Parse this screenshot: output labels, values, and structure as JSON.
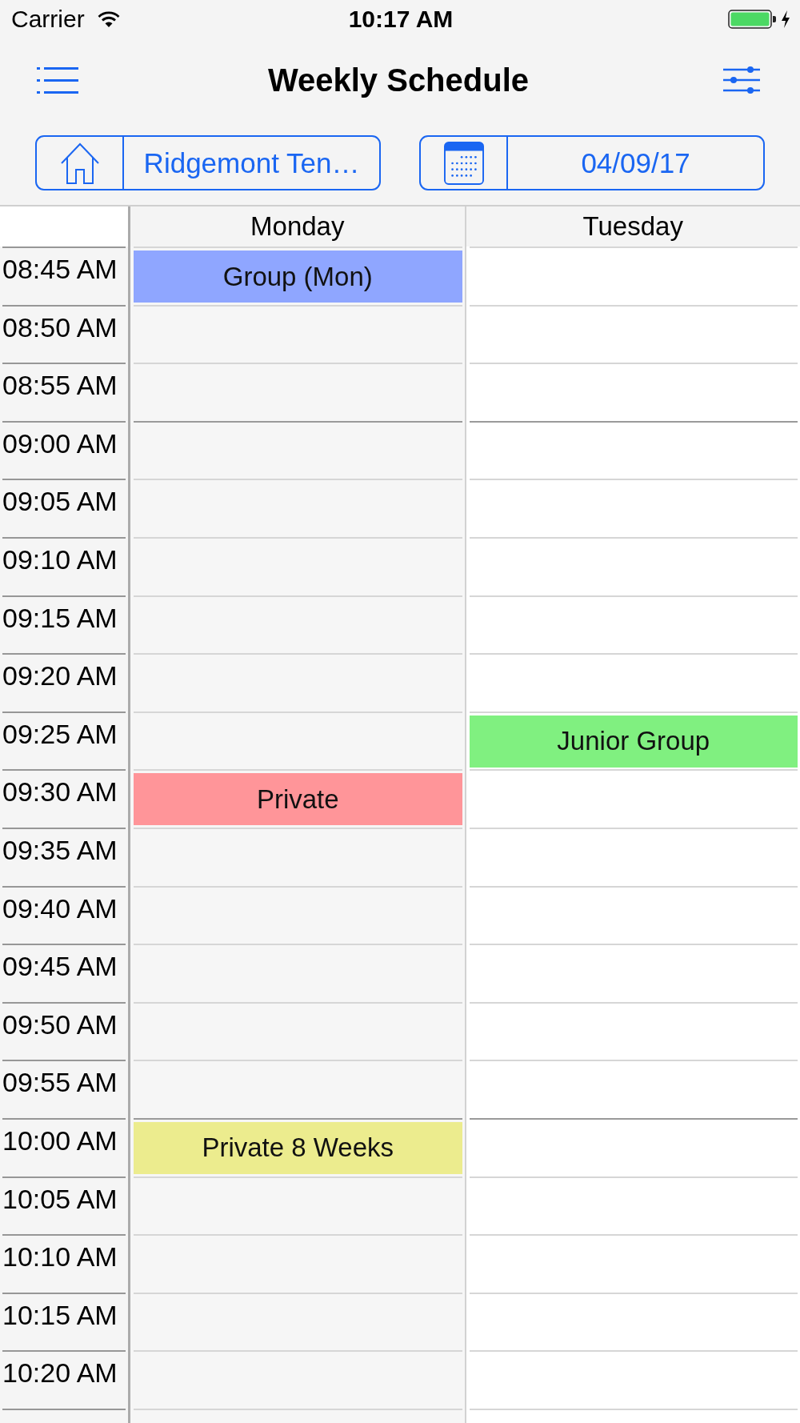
{
  "status_bar": {
    "carrier": "Carrier",
    "time": "10:17 AM"
  },
  "nav_bar": {
    "title": "Weekly Schedule"
  },
  "selectors": [
    {
      "kind": "location",
      "value": "Ridgemont Ten…"
    },
    {
      "kind": "date",
      "value": "04/09/17"
    }
  ],
  "schedule": {
    "days": [
      {
        "name": "Monday"
      },
      {
        "name": "Tuesday"
      }
    ],
    "rows": [
      {
        "time": "08:45 AM",
        "kind": "minor",
        "cells": [
          {
            "kind": "event",
            "title": "Group (Mon)",
            "color": "#8fa6ff"
          },
          {
            "kind": "free"
          }
        ]
      },
      {
        "time": "08:50 AM",
        "kind": "minor",
        "cells": [
          {
            "kind": "free"
          },
          {
            "kind": "free"
          }
        ]
      },
      {
        "time": "08:55 AM",
        "kind": "minor",
        "cells": [
          {
            "kind": "free"
          },
          {
            "kind": "free"
          }
        ]
      },
      {
        "time": "09:00 AM",
        "kind": "hour",
        "cells": [
          {
            "kind": "free"
          },
          {
            "kind": "free"
          }
        ]
      },
      {
        "time": "09:05 AM",
        "kind": "minor",
        "cells": [
          {
            "kind": "free"
          },
          {
            "kind": "free"
          }
        ]
      },
      {
        "time": "09:10 AM",
        "kind": "minor",
        "cells": [
          {
            "kind": "free"
          },
          {
            "kind": "free"
          }
        ]
      },
      {
        "time": "09:15 AM",
        "kind": "minor",
        "cells": [
          {
            "kind": "free"
          },
          {
            "kind": "free"
          }
        ]
      },
      {
        "time": "09:20 AM",
        "kind": "minor",
        "cells": [
          {
            "kind": "free"
          },
          {
            "kind": "free"
          }
        ]
      },
      {
        "time": "09:25 AM",
        "kind": "minor",
        "cells": [
          {
            "kind": "free"
          },
          {
            "kind": "event",
            "title": "Junior Group",
            "color": "#80f080"
          }
        ]
      },
      {
        "time": "09:30 AM",
        "kind": "minor",
        "cells": [
          {
            "kind": "event",
            "title": "Private",
            "color": "#ff9599"
          },
          {
            "kind": "free"
          }
        ]
      },
      {
        "time": "09:35 AM",
        "kind": "minor",
        "cells": [
          {
            "kind": "free"
          },
          {
            "kind": "free"
          }
        ]
      },
      {
        "time": "09:40 AM",
        "kind": "minor",
        "cells": [
          {
            "kind": "free"
          },
          {
            "kind": "free"
          }
        ]
      },
      {
        "time": "09:45 AM",
        "kind": "minor",
        "cells": [
          {
            "kind": "free"
          },
          {
            "kind": "free"
          }
        ]
      },
      {
        "time": "09:50 AM",
        "kind": "minor",
        "cells": [
          {
            "kind": "free"
          },
          {
            "kind": "free"
          }
        ]
      },
      {
        "time": "09:55 AM",
        "kind": "minor",
        "cells": [
          {
            "kind": "free"
          },
          {
            "kind": "free"
          }
        ]
      },
      {
        "time": "10:00 AM",
        "kind": "hour",
        "cells": [
          {
            "kind": "event",
            "title": "Private 8 Weeks",
            "color": "#ecec8e"
          },
          {
            "kind": "free"
          }
        ]
      },
      {
        "time": "10:05 AM",
        "kind": "minor",
        "cells": [
          {
            "kind": "free"
          },
          {
            "kind": "free"
          }
        ]
      },
      {
        "time": "10:10 AM",
        "kind": "minor",
        "cells": [
          {
            "kind": "free"
          },
          {
            "kind": "free"
          }
        ]
      },
      {
        "time": "10:15 AM",
        "kind": "minor",
        "cells": [
          {
            "kind": "free"
          },
          {
            "kind": "free"
          }
        ]
      },
      {
        "time": "10:20 AM",
        "kind": "minor",
        "cells": [
          {
            "kind": "free"
          },
          {
            "kind": "free"
          }
        ]
      },
      {
        "kind": "minor",
        "cells": [
          {
            "kind": "free"
          },
          {
            "kind": "free"
          }
        ]
      }
    ]
  }
}
